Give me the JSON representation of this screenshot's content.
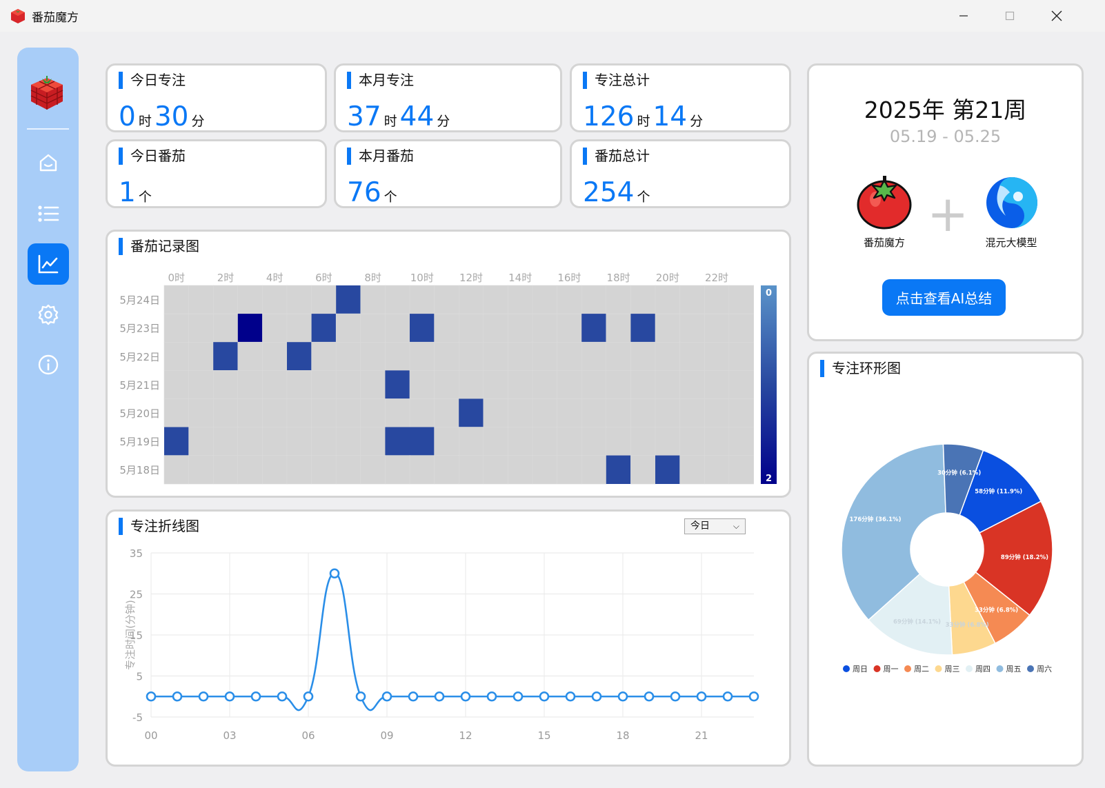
{
  "window": {
    "title": "番茄魔方"
  },
  "stats": [
    {
      "label": "今日专注",
      "hours": "0",
      "hour_unit": "时",
      "minutes": "30",
      "minute_unit": "分"
    },
    {
      "label": "本月专注",
      "hours": "37",
      "hour_unit": "时",
      "minutes": "44",
      "minute_unit": "分"
    },
    {
      "label": "专注总计",
      "hours": "126",
      "hour_unit": "时",
      "minutes": "14",
      "minute_unit": "分"
    },
    {
      "label": "今日番茄",
      "count": "1",
      "count_unit": "个"
    },
    {
      "label": "本月番茄",
      "count": "76",
      "count_unit": "个"
    },
    {
      "label": "番茄总计",
      "count": "254",
      "count_unit": "个"
    }
  ],
  "week_card": {
    "title": "2025年 第21周",
    "range": "05.19 - 05.25",
    "brand_left": "番茄魔方",
    "plus": "+",
    "brand_right": "混元大模型",
    "ai_button": "点击查看AI总结"
  },
  "heatmap": {
    "title": "番茄记录图",
    "colorbar_min": "0",
    "colorbar_max": "2"
  },
  "line": {
    "title": "专注折线图",
    "select_value": "今日"
  },
  "donut": {
    "title": "专注环形图"
  },
  "chart_data": [
    {
      "type": "heatmap",
      "title": "番茄记录图",
      "x": [
        "0时",
        "1时",
        "2时",
        "3时",
        "4时",
        "5时",
        "6时",
        "7时",
        "8时",
        "9时",
        "10时",
        "11时",
        "12时",
        "13时",
        "14时",
        "15时",
        "16时",
        "17时",
        "18时",
        "19时",
        "20时",
        "21时",
        "22时",
        "23时"
      ],
      "x_tick_labels": [
        "0时",
        "2时",
        "4时",
        "6时",
        "8时",
        "10时",
        "12时",
        "14时",
        "16时",
        "18时",
        "20时",
        "22时"
      ],
      "y": [
        "5月24日",
        "5月23日",
        "5月22日",
        "5月21日",
        "5月20日",
        "5月19日",
        "5月18日"
      ],
      "values": [
        [
          0,
          0,
          0,
          0,
          0,
          0,
          0,
          1,
          0,
          0,
          0,
          0,
          0,
          0,
          0,
          0,
          0,
          0,
          0,
          0,
          0,
          0,
          0,
          0
        ],
        [
          0,
          0,
          0,
          2,
          0,
          0,
          1,
          0,
          0,
          0,
          1,
          0,
          0,
          0,
          0,
          0,
          0,
          1,
          0,
          1,
          0,
          0,
          0,
          0
        ],
        [
          0,
          0,
          1,
          0,
          0,
          1,
          0,
          0,
          0,
          0,
          0,
          0,
          0,
          0,
          0,
          0,
          0,
          0,
          0,
          0,
          0,
          0,
          0,
          0
        ],
        [
          0,
          0,
          0,
          0,
          0,
          0,
          0,
          0,
          0,
          1,
          0,
          0,
          0,
          0,
          0,
          0,
          0,
          0,
          0,
          0,
          0,
          0,
          0,
          0
        ],
        [
          0,
          0,
          0,
          0,
          0,
          0,
          0,
          0,
          0,
          0,
          0,
          0,
          1,
          0,
          0,
          0,
          0,
          0,
          0,
          0,
          0,
          0,
          0,
          0
        ],
        [
          1,
          0,
          0,
          0,
          0,
          0,
          0,
          0,
          0,
          1,
          1,
          0,
          0,
          0,
          0,
          0,
          0,
          0,
          0,
          0,
          0,
          0,
          0,
          0
        ],
        [
          0,
          0,
          0,
          0,
          0,
          0,
          0,
          0,
          0,
          0,
          0,
          0,
          0,
          0,
          0,
          0,
          0,
          0,
          1,
          0,
          1,
          0,
          0,
          0
        ]
      ],
      "range": [
        0,
        2
      ],
      "colors": {
        "empty": "#d4d4d4",
        "one": "#2848a0",
        "two": "#00008b",
        "bar_top": "#5a93c9"
      }
    },
    {
      "type": "line",
      "title": "专注折线图",
      "ylabel": "专注时间(分钟)",
      "x": [
        "00",
        "01",
        "02",
        "03",
        "04",
        "05",
        "06",
        "07",
        "08",
        "09",
        "10",
        "11",
        "12",
        "13",
        "14",
        "15",
        "16",
        "17",
        "18",
        "19",
        "20",
        "21",
        "22",
        "23"
      ],
      "x_tick_labels": [
        "00",
        "03",
        "06",
        "09",
        "12",
        "15",
        "18",
        "21"
      ],
      "values": [
        0,
        0,
        0,
        0,
        0,
        0,
        0,
        30,
        0,
        0,
        0,
        0,
        0,
        0,
        0,
        0,
        0,
        0,
        0,
        0,
        0,
        0,
        0,
        0
      ],
      "y_ticks": [
        35,
        25,
        15,
        5,
        -5
      ],
      "ylim": [
        -5,
        35
      ],
      "color": "#2a8ee8"
    },
    {
      "type": "pie",
      "title": "专注环形图",
      "donut": true,
      "series": [
        {
          "name": "周日",
          "value": 58,
          "label": "58分钟 (11.9%)",
          "color": "#0a4fe0"
        },
        {
          "name": "周一",
          "value": 89,
          "label": "89分钟 (18.2%)",
          "color": "#d93425"
        },
        {
          "name": "周二",
          "value": 33,
          "label": "33分钟 (6.8%)",
          "color": "#f58a53"
        },
        {
          "name": "周三",
          "value": 33,
          "label": "33分钟 (6.8%)",
          "color": "#fdd88f"
        },
        {
          "name": "周四",
          "value": 69,
          "label": "69分钟 (14.1%)",
          "color": "#e2f0f4"
        },
        {
          "name": "周五",
          "value": 176,
          "label": "176分钟 (36.1%)",
          "color": "#90bcdf"
        },
        {
          "name": "周六",
          "value": 30,
          "label": "30分钟 (6.1%)",
          "color": "#4a74b5"
        }
      ],
      "legend": "bottom"
    }
  ]
}
